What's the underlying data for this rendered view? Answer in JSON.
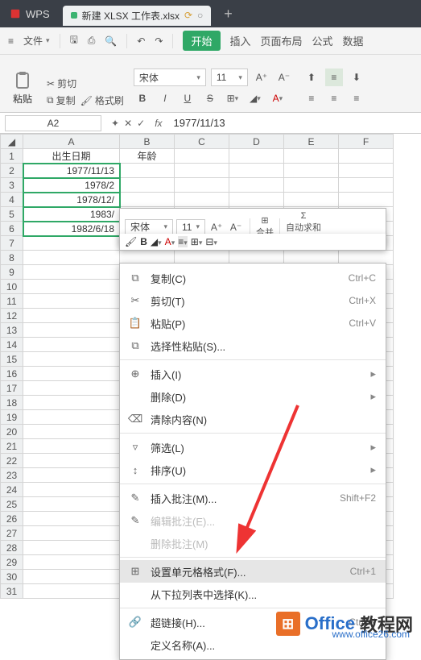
{
  "tabbar": {
    "app": "WPS",
    "filename": "新建 XLSX 工作表.xlsx"
  },
  "menubar": {
    "file": "文件",
    "start": "开始",
    "insert": "插入",
    "layout": "页面布局",
    "formula": "公式",
    "data": "数据"
  },
  "toolbar": {
    "paste": "粘贴",
    "cut": "剪切",
    "copy": "复制",
    "fmtpaint": "格式刷",
    "font": "宋体",
    "size": "11"
  },
  "namebox": {
    "ref": "A2"
  },
  "formulabar": {
    "value": "1977/11/13"
  },
  "columns": [
    "A",
    "B",
    "C",
    "D",
    "E",
    "F"
  ],
  "rows": [
    "1",
    "2",
    "3",
    "4",
    "5",
    "6",
    "7",
    "8",
    "9",
    "10",
    "11",
    "12",
    "13",
    "14",
    "15",
    "16",
    "17",
    "18",
    "19",
    "20",
    "21",
    "22",
    "23",
    "24",
    "25",
    "26",
    "27",
    "28",
    "29",
    "30",
    "31"
  ],
  "cells": {
    "A1": "出生日期",
    "B1": "年龄",
    "A2": "1977/11/13",
    "A3": "1978/2",
    "A4": "1978/12/",
    "A5": "1983/",
    "A6": "1982/6/18"
  },
  "minitoolbar": {
    "font": "宋体",
    "size": "11",
    "merge": "合并",
    "autosum": "自动求和"
  },
  "contextmenu": {
    "copy": {
      "label": "复制(C)",
      "shortcut": "Ctrl+C"
    },
    "cut": {
      "label": "剪切(T)",
      "shortcut": "Ctrl+X"
    },
    "paste": {
      "label": "粘贴(P)",
      "shortcut": "Ctrl+V"
    },
    "pastesp": {
      "label": "选择性粘贴(S)..."
    },
    "insert": {
      "label": "插入(I)"
    },
    "delete": {
      "label": "删除(D)"
    },
    "clear": {
      "label": "清除内容(N)"
    },
    "filter": {
      "label": "筛选(L)"
    },
    "sort": {
      "label": "排序(U)"
    },
    "inscom": {
      "label": "插入批注(M)...",
      "shortcut": "Shift+F2"
    },
    "editcom": {
      "label": "编辑批注(E)..."
    },
    "delcom": {
      "label": "删除批注(M)"
    },
    "format": {
      "label": "设置单元格格式(F)...",
      "shortcut": "Ctrl+1"
    },
    "dropdown": {
      "label": "从下拉列表中选择(K)..."
    },
    "hyper": {
      "label": "超链接(H)...",
      "shortcut": "Ctrl+K"
    },
    "defname": {
      "label": "定义名称(A)..."
    }
  },
  "watermark": {
    "brand": "Office",
    "suffix": "教程网",
    "url": "www.office26.com"
  }
}
